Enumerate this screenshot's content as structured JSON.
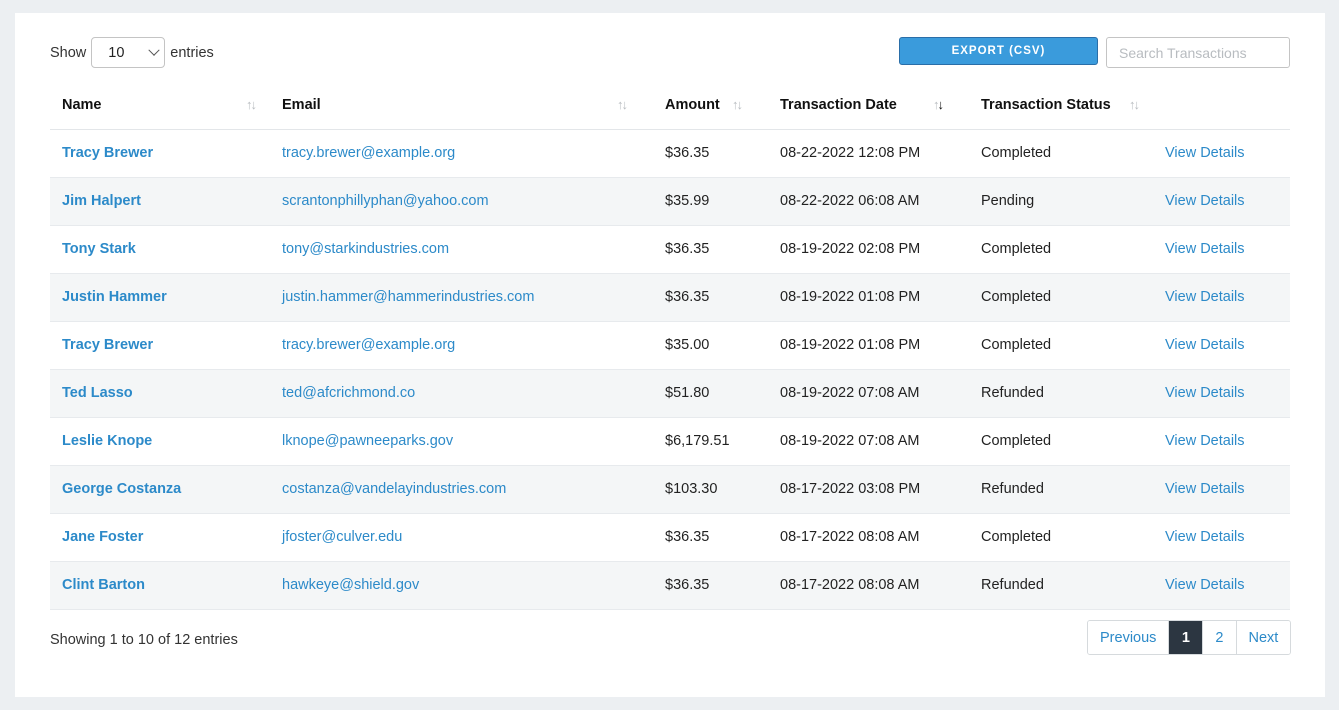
{
  "length": {
    "show_label": "Show",
    "value": "10",
    "entries_label": "entries"
  },
  "toolbar": {
    "export_label": "EXPORT (CSV)",
    "search_placeholder": "Search Transactions"
  },
  "table": {
    "headers": [
      "Name",
      "Email",
      "Amount",
      "Transaction Date",
      "Transaction Status"
    ],
    "rows": [
      {
        "name": "Tracy Brewer",
        "email": "tracy.brewer@example.org",
        "amount": "$36.35",
        "date": "08-22-2022 12:08 PM",
        "status": "Completed",
        "action": "View Details"
      },
      {
        "name": "Jim Halpert",
        "email": "scrantonphillyphan@yahoo.com",
        "amount": "$35.99",
        "date": "08-22-2022 06:08 AM",
        "status": "Pending",
        "action": "View Details"
      },
      {
        "name": "Tony Stark",
        "email": "tony@starkindustries.com",
        "amount": "$36.35",
        "date": "08-19-2022 02:08 PM",
        "status": "Completed",
        "action": "View Details"
      },
      {
        "name": "Justin Hammer",
        "email": "justin.hammer@hammerindustries.com",
        "amount": "$36.35",
        "date": "08-19-2022 01:08 PM",
        "status": "Completed",
        "action": "View Details"
      },
      {
        "name": "Tracy Brewer",
        "email": "tracy.brewer@example.org",
        "amount": "$35.00",
        "date": "08-19-2022 01:08 PM",
        "status": "Completed",
        "action": "View Details"
      },
      {
        "name": "Ted Lasso",
        "email": "ted@afcrichmond.co",
        "amount": "$51.80",
        "date": "08-19-2022 07:08 AM",
        "status": "Refunded",
        "action": "View Details"
      },
      {
        "name": "Leslie Knope",
        "email": "lknope@pawneeparks.gov",
        "amount": "$6,179.51",
        "date": "08-19-2022 07:08 AM",
        "status": "Completed",
        "action": "View Details"
      },
      {
        "name": "George Costanza",
        "email": "costanza@vandelayindustries.com",
        "amount": "$103.30",
        "date": "08-17-2022 03:08 PM",
        "status": "Refunded",
        "action": "View Details"
      },
      {
        "name": "Jane Foster",
        "email": "jfoster@culver.edu",
        "amount": "$36.35",
        "date": "08-17-2022 08:08 AM",
        "status": "Completed",
        "action": "View Details"
      },
      {
        "name": "Clint Barton",
        "email": "hawkeye@shield.gov",
        "amount": "$36.35",
        "date": "08-17-2022 08:08 AM",
        "status": "Refunded",
        "action": "View Details"
      }
    ]
  },
  "footer": {
    "info": "Showing 1 to 10 of 12 entries",
    "pager": {
      "previous": "Previous",
      "pages": [
        "1",
        "2"
      ],
      "active": "1",
      "next": "Next"
    }
  },
  "colors": {
    "accent": "#2c8ac9",
    "export_bg": "#3a9bdc",
    "active_page_bg": "#2c3641"
  }
}
